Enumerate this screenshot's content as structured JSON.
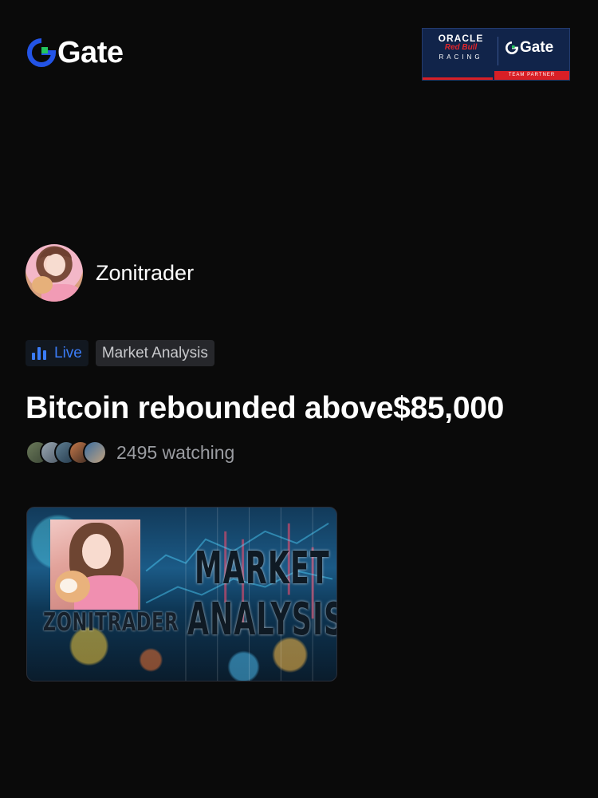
{
  "header": {
    "brand_name": "Gate",
    "brand_color": "#2354e6",
    "brand_accent": "#22c55e",
    "partner": {
      "line1": "ORACLE",
      "line2": "Red Bull",
      "line3": "RACING",
      "gate_label": "Gate",
      "badge": "TEAM PARTNER"
    }
  },
  "streamer": {
    "name": "Zonitrader"
  },
  "tags": {
    "live": "Live",
    "topic": "Market Analysis",
    "live_color": "#3b7cf6"
  },
  "stream": {
    "title": "Bitcoin rebounded above$85,000",
    "viewer_count": "2495",
    "viewer_label": "2495 watching"
  },
  "thumbnail": {
    "name_text": "ZONITRADER",
    "headline_line1": "MARKET",
    "headline_line2": "ANALYSIS"
  }
}
